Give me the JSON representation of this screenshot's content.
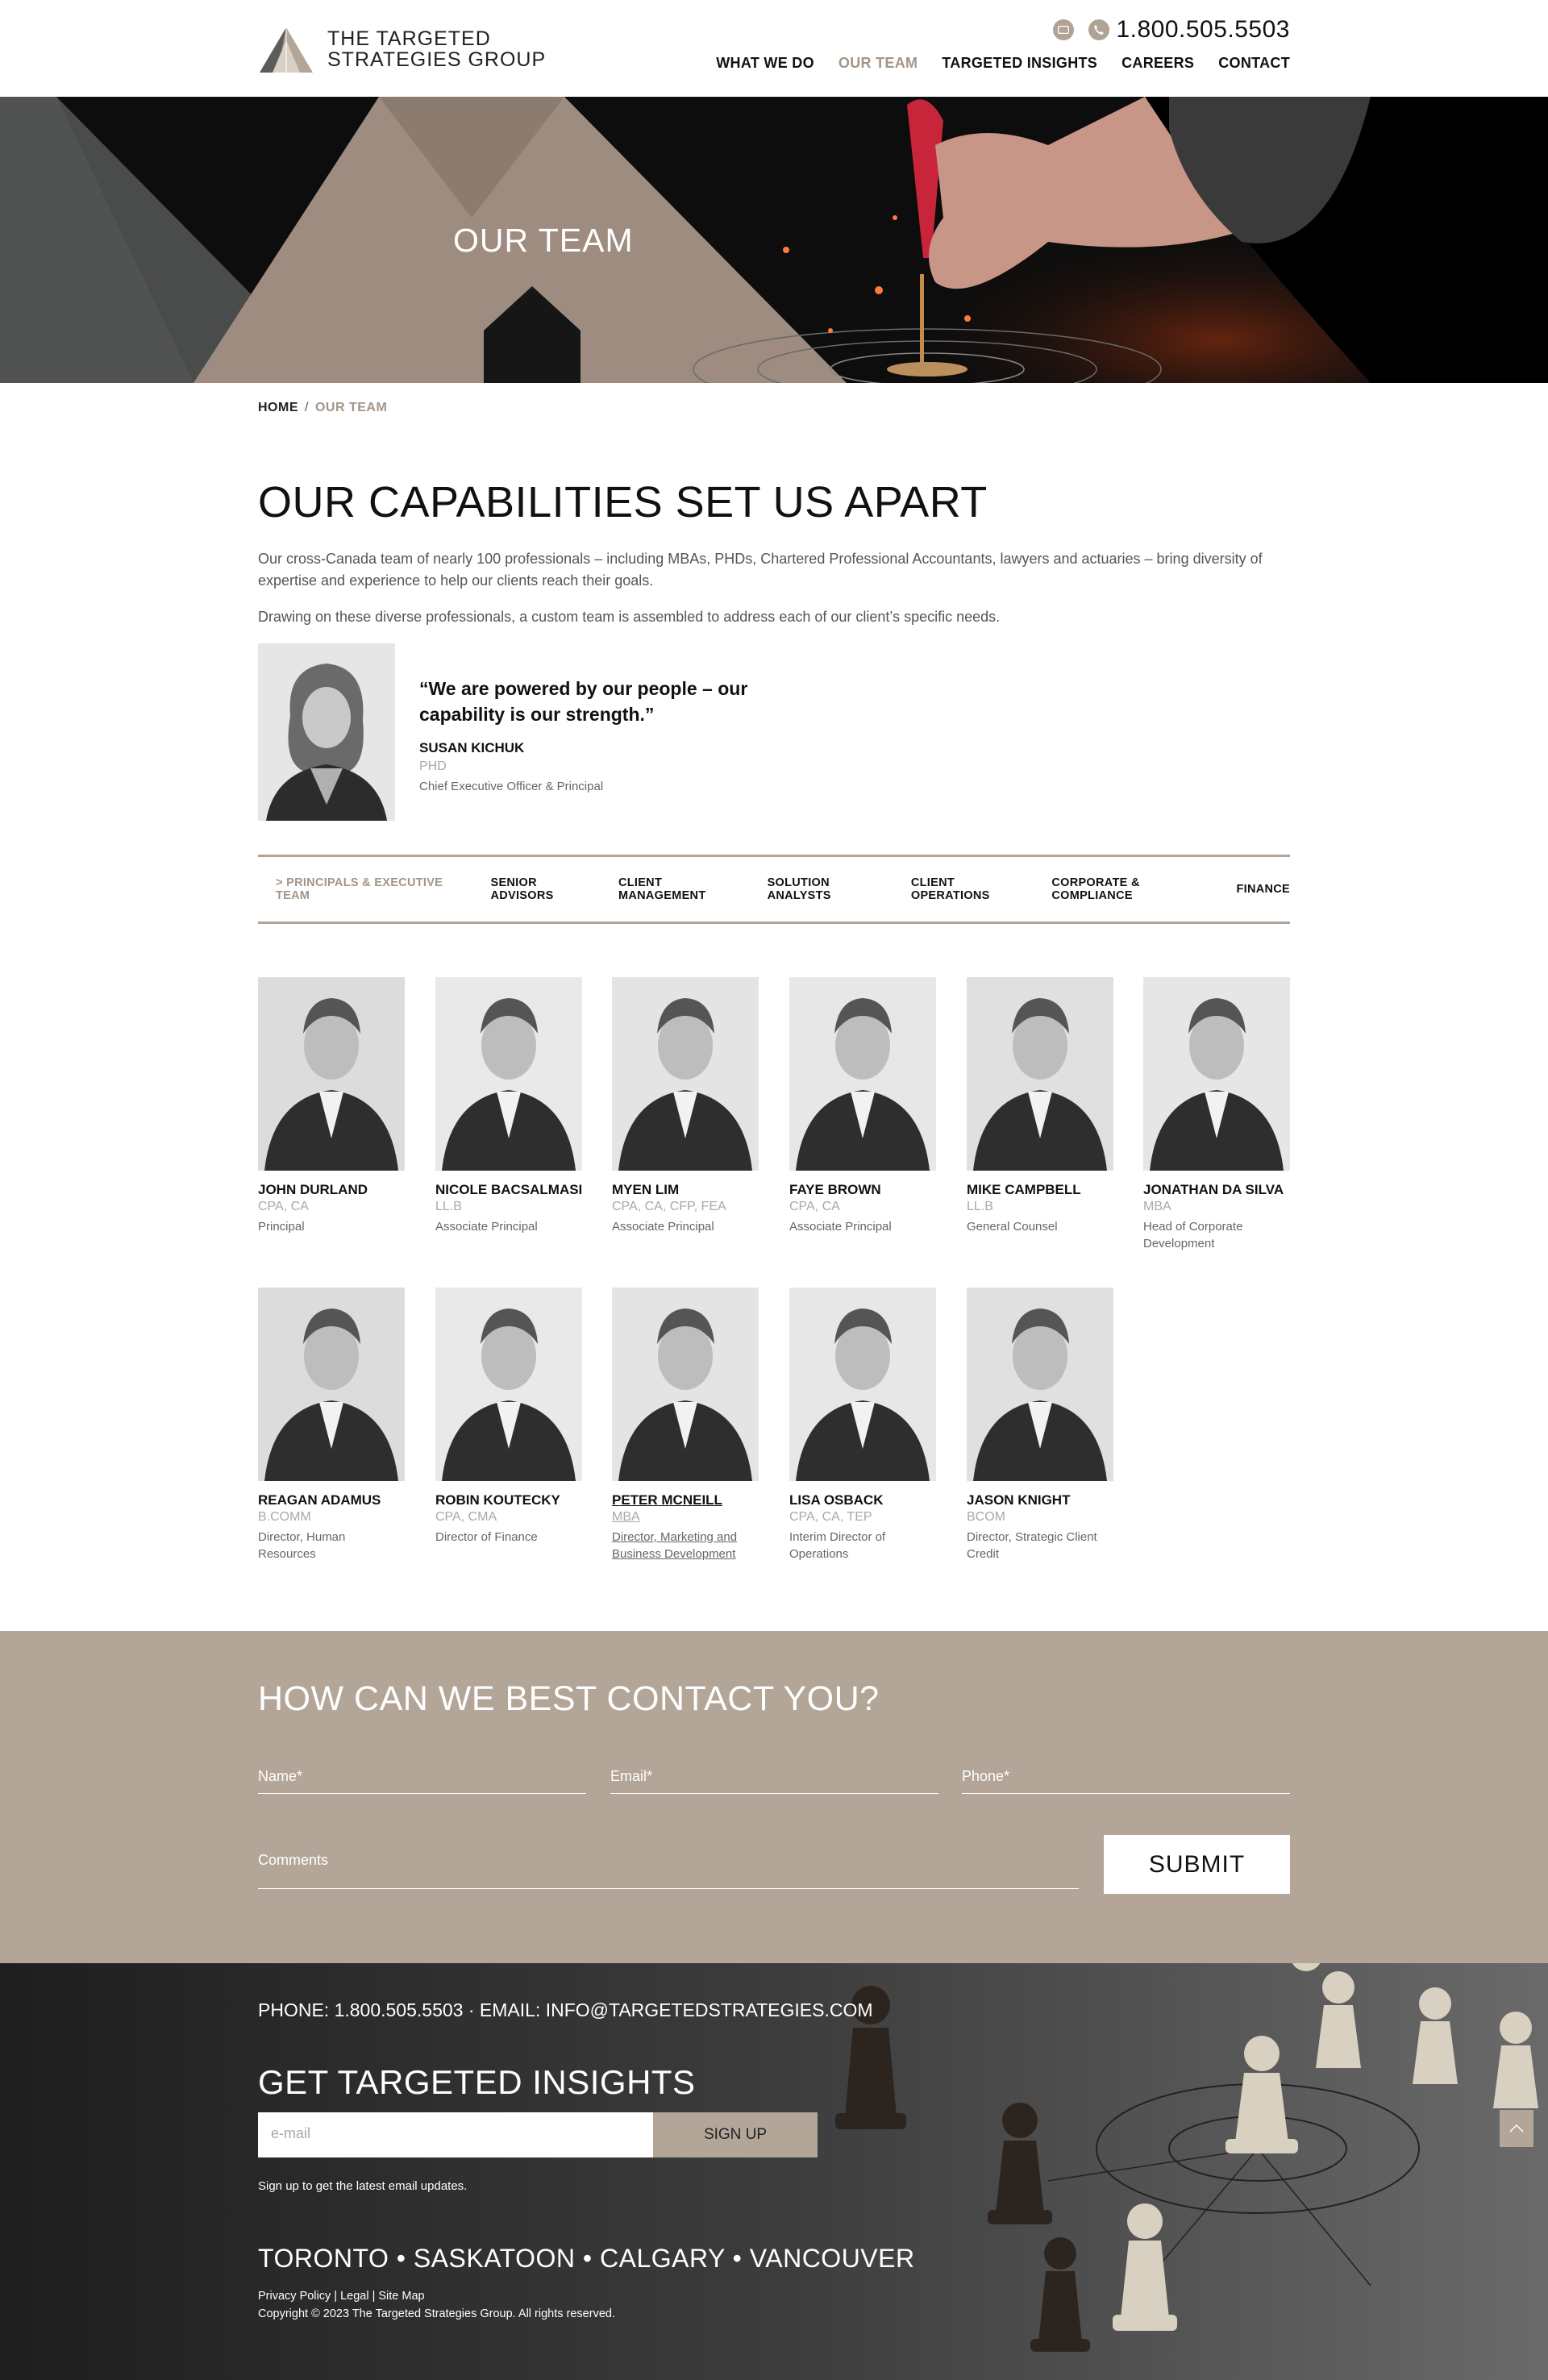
{
  "brand": {
    "line1": "THE TARGETED",
    "line2": "STRATEGIES GROUP",
    "accent": "#a39587",
    "sand": "#b3a698"
  },
  "header": {
    "phone": "1.800.505.5503",
    "nav": [
      "WHAT WE DO",
      "OUR TEAM",
      "TARGETED INSIGHTS",
      "CAREERS",
      "CONTACT"
    ],
    "nav_active": "OUR TEAM"
  },
  "hero": {
    "title": "OUR TEAM"
  },
  "breadcrumb": {
    "home": "HOME",
    "sep": "/",
    "current": "OUR TEAM"
  },
  "intro": {
    "heading": "OUR CAPABILITIES SET US APART",
    "para1": "Our cross-Canada team of nearly 100 professionals – including MBAs, PHDs, Chartered Professional Accountants, lawyers and actuaries – bring diversity of expertise and experience to help our clients reach their goals.",
    "para2": "Drawing on these diverse professionals, a custom team is assembled to address each of our client’s specific needs."
  },
  "ceo": {
    "quote": "“We are powered by our people – our capability is our strength.”",
    "name": "SUSAN KICHUK",
    "credentials": "PHD",
    "title": "Chief Executive Officer & Principal"
  },
  "tabs": [
    "> PRINCIPALS & EXECUTIVE TEAM",
    "SENIOR ADVISORS",
    "CLIENT MANAGEMENT",
    "SOLUTION ANALYSTS",
    "CLIENT OPERATIONS",
    "CORPORATE & COMPLIANCE",
    "FINANCE"
  ],
  "team": [
    {
      "name": "JOHN DURLAND",
      "credentials": "CPA, CA",
      "title": "Principal"
    },
    {
      "name": "NICOLE BACSALMASI",
      "credentials": "LL.B",
      "title": "Associate Principal"
    },
    {
      "name": "MYEN LIM",
      "credentials": "CPA, CA, CFP, FEA",
      "title": "Associate Principal"
    },
    {
      "name": "FAYE BROWN",
      "credentials": "CPA, CA",
      "title": "Associate Principal"
    },
    {
      "name": "MIKE CAMPBELL",
      "credentials": "LL.B",
      "title": "General Counsel"
    },
    {
      "name": "JONATHAN DA SILVA",
      "credentials": "MBA",
      "title": "Head of Corporate Development"
    },
    {
      "name": "REAGAN ADAMUS",
      "credentials": "B.COMM",
      "title": "Director, Human Resources"
    },
    {
      "name": "ROBIN KOUTECKY",
      "credentials": "CPA, CMA",
      "title": "Director of Finance"
    },
    {
      "name": "PETER MCNEILL",
      "credentials": "MBA",
      "title": "Director, Marketing and Business Development"
    },
    {
      "name": "LISA OSBACK",
      "credentials": "CPA, CA, TEP",
      "title": "Interim Director of Operations"
    },
    {
      "name": "JASON KNIGHT",
      "credentials": "BCOM",
      "title": "Director, Strategic Client Credit"
    }
  ],
  "contact": {
    "heading": "HOW CAN WE BEST CONTACT YOU?",
    "name_ph": "Name*",
    "email_ph": "Email*",
    "phone_ph": "Phone*",
    "comments_ph": "Comments",
    "submit": "SUBMIT"
  },
  "footer": {
    "contact_line": "PHONE: 1.800.505.5503 · EMAIL: INFO@TARGETEDSTRATEGIES.COM",
    "insights_heading": "GET TARGETED INSIGHTS",
    "email_ph": "e-mail",
    "signup": "SIGN UP",
    "signup_note": "Sign up to get the latest email updates.",
    "cities": "TORONTO • SASKATOON • CALGARY • VANCOUVER",
    "links": [
      "Privacy Policy",
      "Legal",
      "Site Map"
    ],
    "copyright": "Copyright © 2023 The Targeted Strategies Group. All rights reserved."
  }
}
